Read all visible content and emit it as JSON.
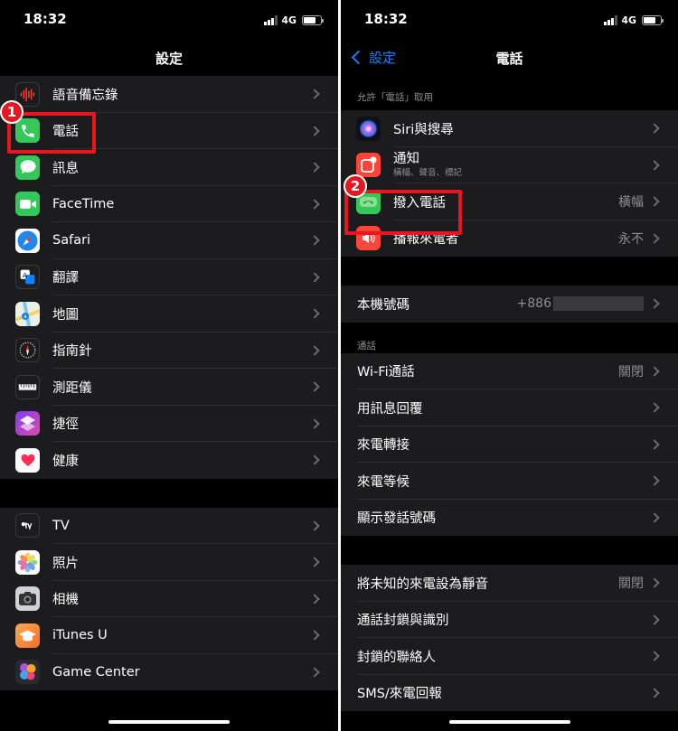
{
  "left": {
    "status": {
      "time": "18:32",
      "network": "4G"
    },
    "title": "設定",
    "groups": [
      {
        "items": [
          {
            "label": "語音備忘錄",
            "icon": "voice-memos-icon"
          },
          {
            "label": "電話",
            "icon": "phone-icon"
          },
          {
            "label": "訊息",
            "icon": "messages-icon"
          },
          {
            "label": "FaceTime",
            "icon": "facetime-icon"
          },
          {
            "label": "Safari",
            "icon": "safari-icon"
          },
          {
            "label": "翻譯",
            "icon": "translate-icon"
          },
          {
            "label": "地圖",
            "icon": "maps-icon"
          },
          {
            "label": "指南針",
            "icon": "compass-icon"
          },
          {
            "label": "測距儀",
            "icon": "measure-icon"
          },
          {
            "label": "捷徑",
            "icon": "shortcuts-icon"
          },
          {
            "label": "健康",
            "icon": "health-icon"
          }
        ]
      },
      {
        "items": [
          {
            "label": "TV",
            "icon": "tv-icon"
          },
          {
            "label": "照片",
            "icon": "photos-icon"
          },
          {
            "label": "相機",
            "icon": "camera-icon"
          },
          {
            "label": "iTunes U",
            "icon": "itunes-u-icon"
          },
          {
            "label": "Game Center",
            "icon": "game-center-icon"
          }
        ]
      }
    ],
    "badge": "1"
  },
  "right": {
    "status": {
      "time": "18:32",
      "network": "4G"
    },
    "back_label": "設定",
    "title": "電話",
    "section1_header": "允許「電話」取用",
    "section1": [
      {
        "label": "Siri與搜尋",
        "icon": "siri-icon",
        "value": ""
      },
      {
        "label": "通知",
        "sub": "橫幅、聲音、標記",
        "icon": "notifications-icon",
        "value": ""
      },
      {
        "label": "撥入電話",
        "icon": "incoming-call-icon",
        "value": "橫幅"
      },
      {
        "label": "播報來電者",
        "icon": "announce-calls-icon",
        "value": "永不"
      }
    ],
    "my_number": {
      "label": "本機號碼",
      "value": "+886"
    },
    "calls_header": "通話",
    "calls": [
      {
        "label": "Wi-Fi通話",
        "value": "關閉"
      },
      {
        "label": "用訊息回覆",
        "value": ""
      },
      {
        "label": "來電轉接",
        "value": ""
      },
      {
        "label": "來電等候",
        "value": ""
      },
      {
        "label": "顯示發話號碼",
        "value": ""
      }
    ],
    "blocking": [
      {
        "label": "將未知的來電設為靜音",
        "value": "關閉"
      },
      {
        "label": "通話封鎖與識別",
        "value": ""
      },
      {
        "label": "封鎖的聯絡人",
        "value": ""
      },
      {
        "label": "SMS/來電回報",
        "value": ""
      }
    ],
    "badge": "2"
  },
  "colors": {
    "accent": "#0a84ff",
    "highlight": "#e8161e",
    "cell": "#1c1c1e",
    "secondary_text": "#8e8e93"
  }
}
